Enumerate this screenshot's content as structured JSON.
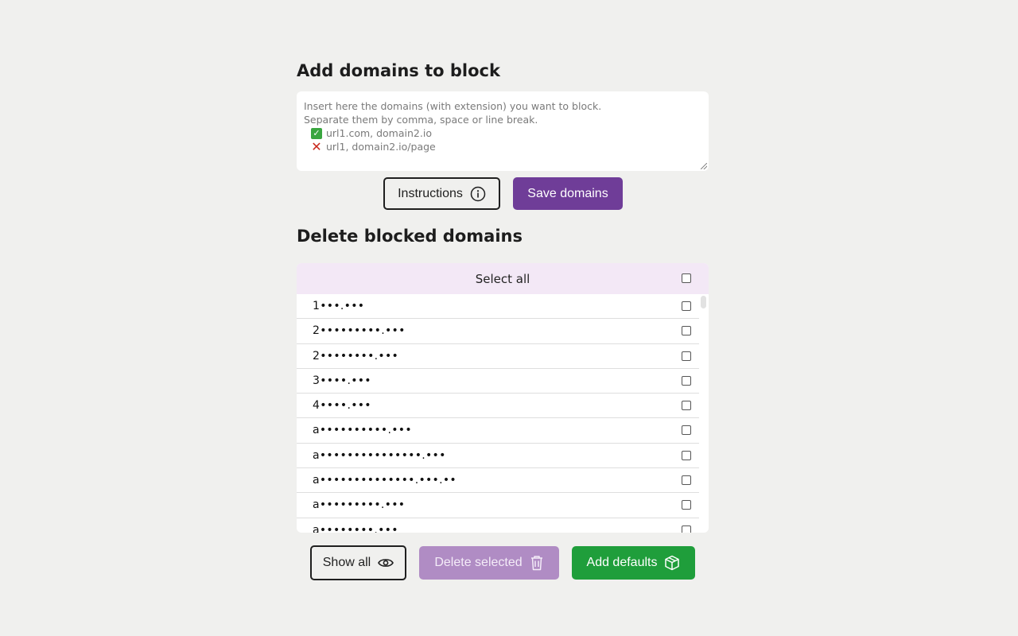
{
  "add_section": {
    "title": "Add domains to block",
    "placeholder_lines": [
      "Insert here the domains (with extension) you want to block.",
      "Separate them by comma, space or line break."
    ],
    "example_good": "url1.com, domain2.io",
    "example_bad": "url1, domain2.io/page",
    "instructions_label": "Instructions",
    "save_label": "Save domains"
  },
  "delete_section": {
    "title": "Delete blocked domains",
    "select_all_label": "Select all",
    "rows": [
      "1•••.•••",
      "2•••••••••.•••",
      "2••••••••.•••",
      "3••••.•••",
      "4••••.•••",
      "a••••••••••.•••",
      "a•••••••••••••••.•••",
      "a••••••••••••••.•••.••",
      "a•••••••••.•••",
      "a••••••••.•••"
    ],
    "show_all_label": "Show all",
    "delete_label": "Delete selected",
    "defaults_label": "Add defaults"
  },
  "colors": {
    "accent_purple": "#6f3d98",
    "disabled_purple": "#b08cc4",
    "green": "#1f9e3b",
    "header_bg": "#f3e8f6"
  }
}
